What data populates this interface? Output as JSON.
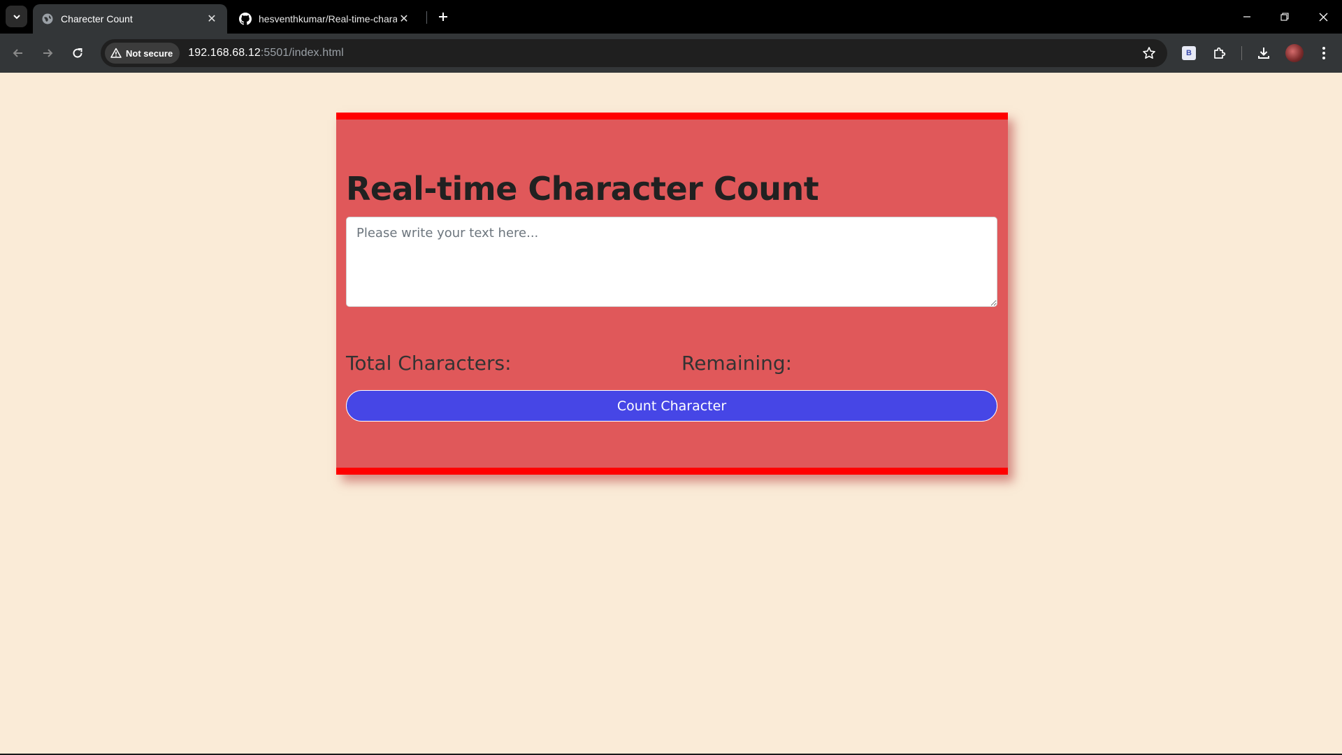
{
  "browser": {
    "tabs": [
      {
        "title": "Charecter Count",
        "active": true,
        "favicon": "globe-icon"
      },
      {
        "title": "hesventhkumar/Real-time-character-count",
        "active": false,
        "favicon": "github-icon"
      }
    ],
    "security_label": "Not secure",
    "url_host": "192.168.68.12",
    "url_rest": ":5501/index.html",
    "extension_label": "B"
  },
  "page": {
    "heading": "Real-time Character Count",
    "textarea_value": "",
    "textarea_placeholder": "Please write your text here...",
    "total_label": "Total Characters:",
    "total_value": "",
    "remaining_label": "Remaining:",
    "remaining_value": "",
    "button_label": "Count Character"
  },
  "colors": {
    "page_background": "#faebd7",
    "card_background": "#e0585a",
    "card_border": "#ff0000",
    "button_background": "#4646e6"
  }
}
